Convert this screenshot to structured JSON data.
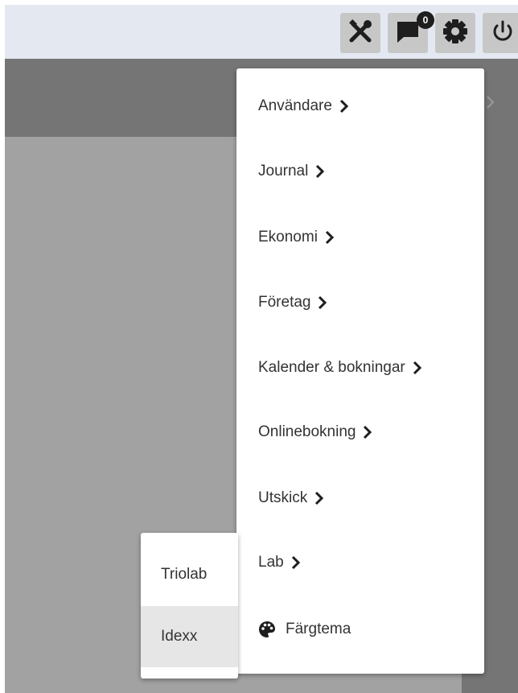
{
  "topbar": {
    "buttons": [
      {
        "icon": "tools-icon"
      },
      {
        "icon": "chat-icon"
      },
      {
        "icon": "gear-icon"
      },
      {
        "icon": "power-icon"
      }
    ],
    "notification_count": "0"
  },
  "menu": {
    "items": [
      {
        "label": "Användare",
        "has_submenu": true
      },
      {
        "label": "Journal",
        "has_submenu": true
      },
      {
        "label": "Ekonomi",
        "has_submenu": true
      },
      {
        "label": "Företag",
        "has_submenu": true
      },
      {
        "label": "Kalender & bokningar",
        "has_submenu": true
      },
      {
        "label": "Onlinebokning",
        "has_submenu": true
      },
      {
        "label": "Utskick",
        "has_submenu": true
      },
      {
        "label": "Lab",
        "has_submenu": true
      }
    ],
    "theme_item": {
      "label": "Färgtema",
      "icon": "palette-icon"
    }
  },
  "lab_submenu": {
    "items": [
      {
        "label": "Triolab",
        "active": false
      },
      {
        "label": "Idexx",
        "active": true
      }
    ]
  },
  "colors": {
    "topbar_bg": "#e4e9f1",
    "header_band": "#757575",
    "overlay_bg": "#a2a2a2",
    "text": "#333333",
    "icon": "#1e1e1e"
  }
}
